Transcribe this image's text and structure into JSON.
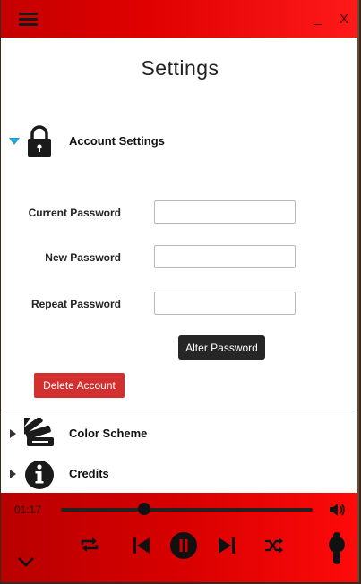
{
  "window": {
    "menu_icon": "hamburger-icon",
    "minimize_icon": "minimize-icon",
    "close_label": "X"
  },
  "page": {
    "title": "Settings"
  },
  "account_section": {
    "label": "Account Settings",
    "expanded": true,
    "icon": "lock-icon",
    "fields": [
      {
        "label": "Current Password",
        "value": "",
        "placeholder": ""
      },
      {
        "label": "New Password",
        "value": "",
        "placeholder": ""
      },
      {
        "label": "Repeat Password",
        "value": "",
        "placeholder": ""
      }
    ],
    "alter_button": "Alter Password",
    "delete_button": "Delete Account"
  },
  "sections": [
    {
      "label": "Color Scheme",
      "icon": "color-swatch-icon",
      "expanded": false
    },
    {
      "label": "Credits",
      "icon": "info-icon",
      "expanded": false
    }
  ],
  "player": {
    "elapsed": "01:17",
    "progress": 0.33,
    "volume": 0.6,
    "controls": [
      "repeat-icon",
      "previous-icon",
      "pause-icon",
      "next-icon",
      "shuffle-icon"
    ]
  },
  "colors": {
    "accent": "#e00000",
    "expand_arrow": "#1da1d6",
    "delete": "#d32f2f",
    "primary_button": "#262626"
  }
}
